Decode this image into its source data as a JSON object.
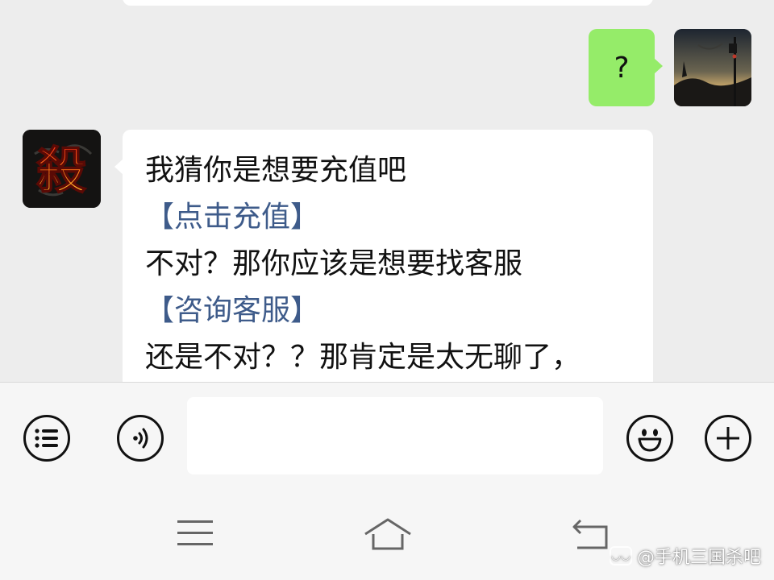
{
  "chat": {
    "messages": [
      {
        "sender": "me",
        "text": "?"
      },
      {
        "sender": "bot",
        "lines": [
          {
            "text": "我猜你是想要充值吧",
            "type": "text"
          },
          {
            "text": "【点击充值】",
            "type": "link"
          },
          {
            "text": "不对？那你应该是想要找客服",
            "type": "text"
          },
          {
            "text": "【咨询客服】",
            "type": "link"
          },
          {
            "text": "还是不对？？那肯定是太无聊了，",
            "type": "text"
          }
        ]
      }
    ],
    "bot_avatar_glyph": "殺"
  },
  "input_bar": {
    "icons": {
      "menu": "list-menu-icon",
      "voice": "voice-icon",
      "emoji": "emoji-icon",
      "plus": "plus-icon"
    },
    "text_value": ""
  },
  "nav_bar": {
    "icons": [
      "menu-lines-icon",
      "home-icon",
      "back-icon"
    ]
  },
  "watermark": {
    "text": "@手机三国杀吧"
  },
  "colors": {
    "background": "#ededed",
    "bubble_me": "#95ec69",
    "bubble_bot": "#ffffff",
    "link": "#3e5b8a"
  }
}
